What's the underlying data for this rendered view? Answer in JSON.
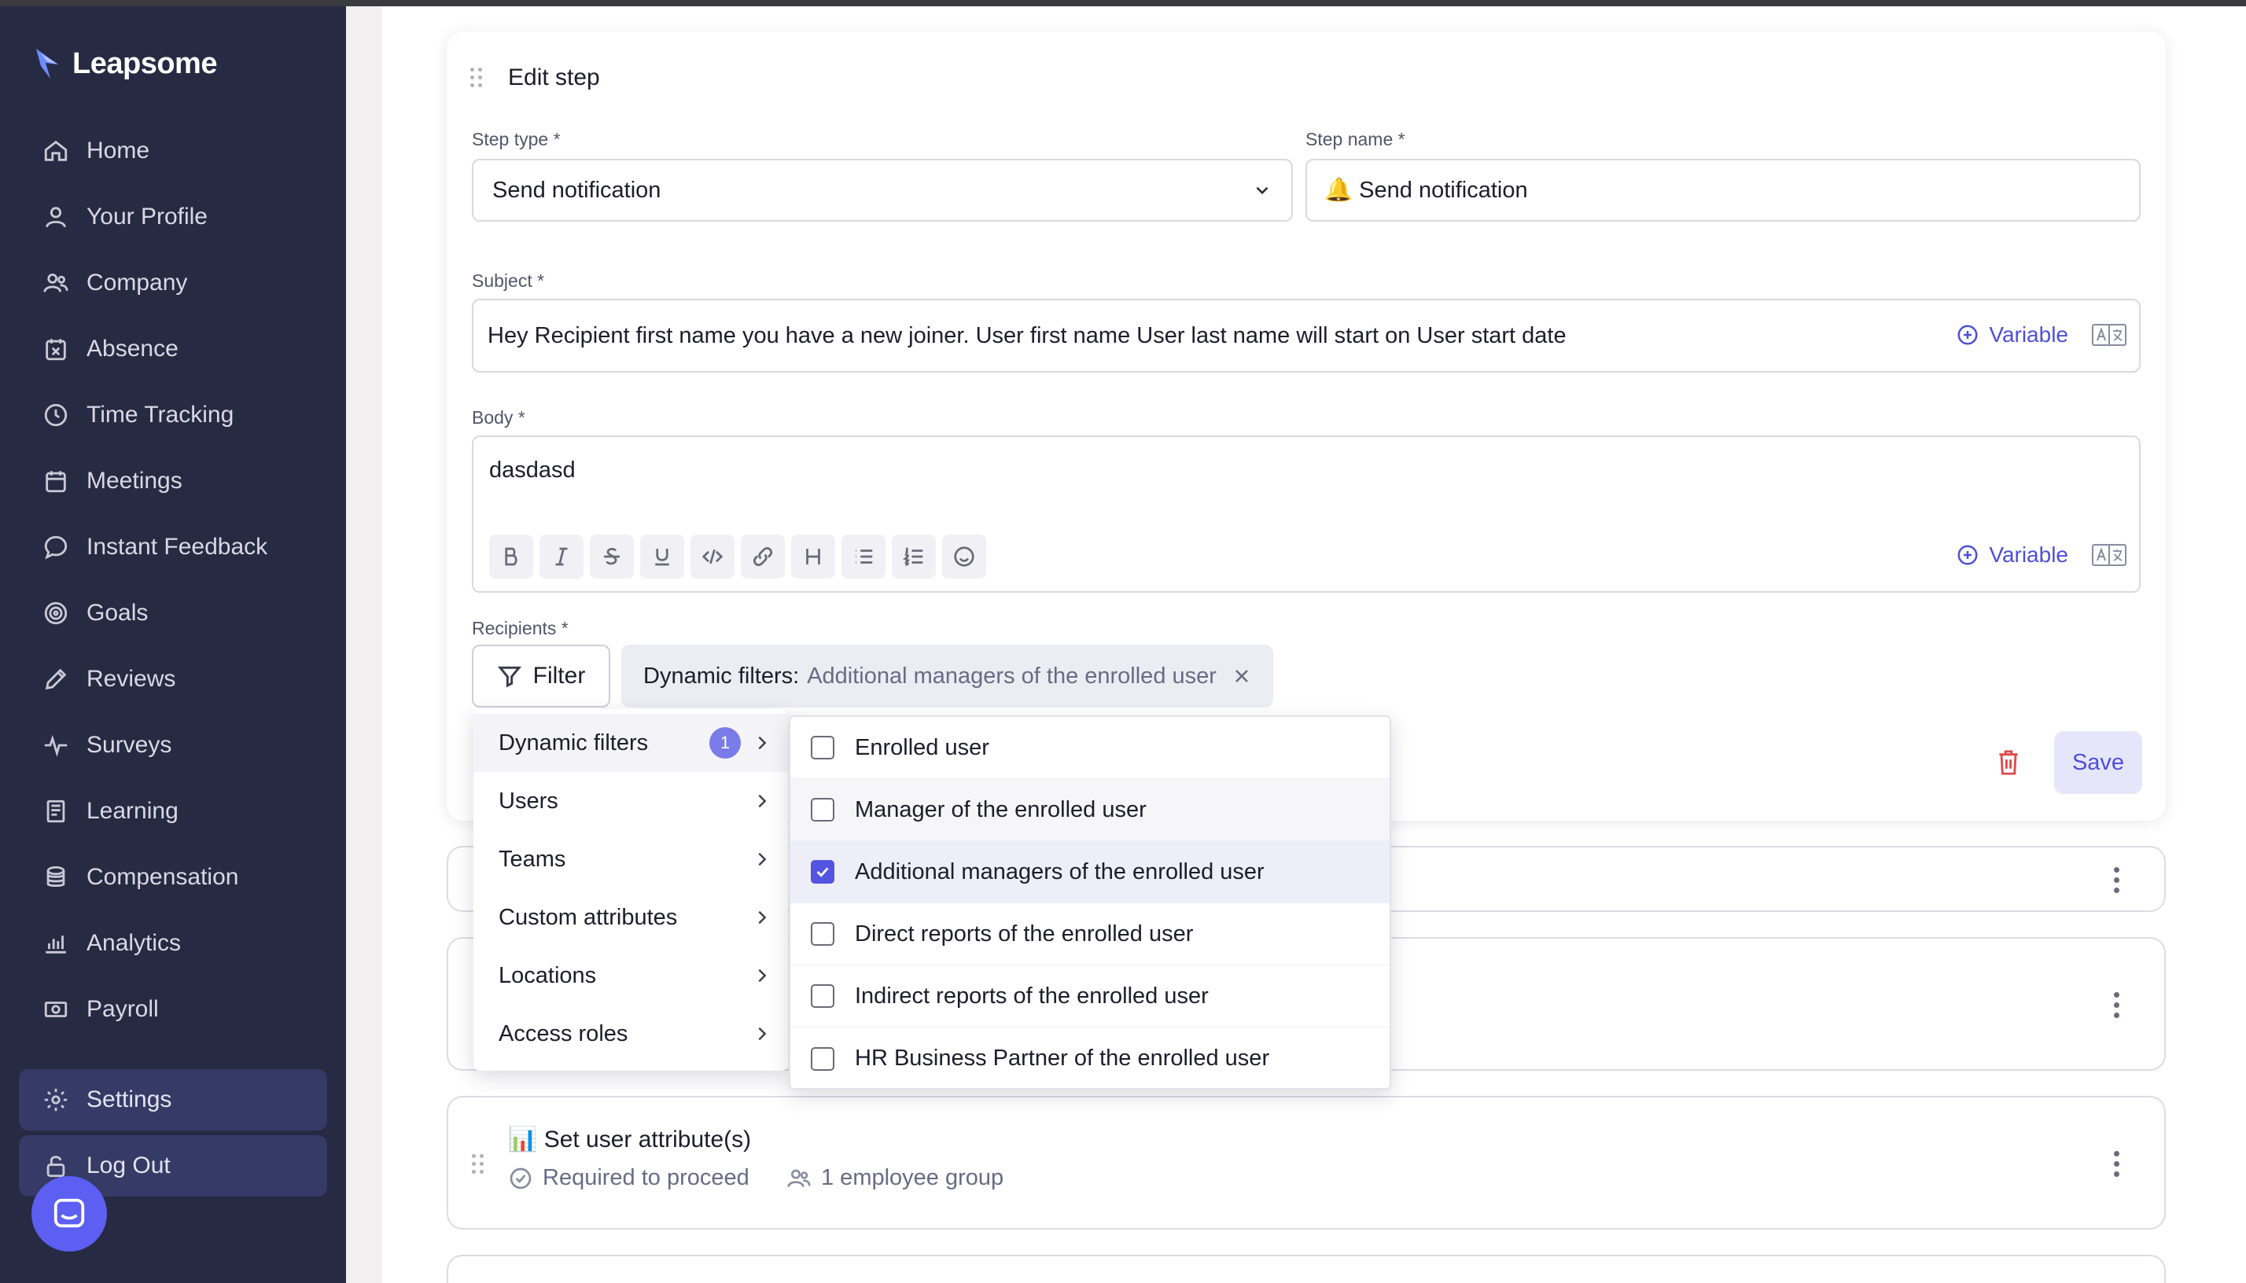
{
  "app": {
    "brand": "Leapsome"
  },
  "sidebar": {
    "items": [
      {
        "label": "Home",
        "icon": "home-icon"
      },
      {
        "label": "Your Profile",
        "icon": "user-icon"
      },
      {
        "label": "Company",
        "icon": "users-icon"
      },
      {
        "label": "Absence",
        "icon": "calendar-x-icon"
      },
      {
        "label": "Time Tracking",
        "icon": "clock-icon"
      },
      {
        "label": "Meetings",
        "icon": "calendar-icon"
      },
      {
        "label": "Instant Feedback",
        "icon": "chat-icon"
      },
      {
        "label": "Goals",
        "icon": "target-icon"
      },
      {
        "label": "Reviews",
        "icon": "pencil-icon"
      },
      {
        "label": "Surveys",
        "icon": "pulse-icon"
      },
      {
        "label": "Learning",
        "icon": "book-icon"
      },
      {
        "label": "Compensation",
        "icon": "coins-icon"
      },
      {
        "label": "Analytics",
        "icon": "bar-chart-icon"
      },
      {
        "label": "Payroll",
        "icon": "money-icon"
      }
    ],
    "settings_label": "Settings",
    "logout_label": "Log Out"
  },
  "edit_step": {
    "title": "Edit step",
    "step_type_label": "Step type *",
    "step_type_value": "Send notification",
    "step_name_label": "Step name *",
    "step_name_value": "🔔 Send notification",
    "subject_label": "Subject *",
    "subject_value": "Hey Recipient first name you have a new joiner. User first name User last name will start on User start date",
    "body_label": "Body *",
    "body_value": "dasdasd",
    "variable_label": "Variable",
    "recipients_label": "Recipients *",
    "filter_label": "Filter",
    "chip_key": "Dynamic filters:",
    "chip_value": "Additional managers of the enrolled user",
    "save_label": "Save"
  },
  "filter_menu": {
    "categories": [
      {
        "label": "Dynamic filters",
        "count": "1"
      },
      {
        "label": "Users"
      },
      {
        "label": "Teams"
      },
      {
        "label": "Custom attributes"
      },
      {
        "label": "Locations"
      },
      {
        "label": "Access roles"
      }
    ],
    "options": [
      {
        "label": "Enrolled user",
        "checked": false
      },
      {
        "label": "Manager of the enrolled user",
        "checked": false
      },
      {
        "label": "Additional managers of the enrolled user",
        "checked": true
      },
      {
        "label": "Direct reports of the enrolled user",
        "checked": false
      },
      {
        "label": "Indirect reports of the enrolled user",
        "checked": false
      },
      {
        "label": "HR Business Partner of the enrolled user",
        "checked": false
      }
    ]
  },
  "steps": {
    "set_attribute_title": "📊 Set user attribute(s)",
    "required_label": "Required to proceed",
    "group_label": "1 employee group"
  },
  "colors": {
    "sidebar": "#272a43",
    "accent": "#4f4fd8",
    "checkbox": "#5554e0"
  }
}
